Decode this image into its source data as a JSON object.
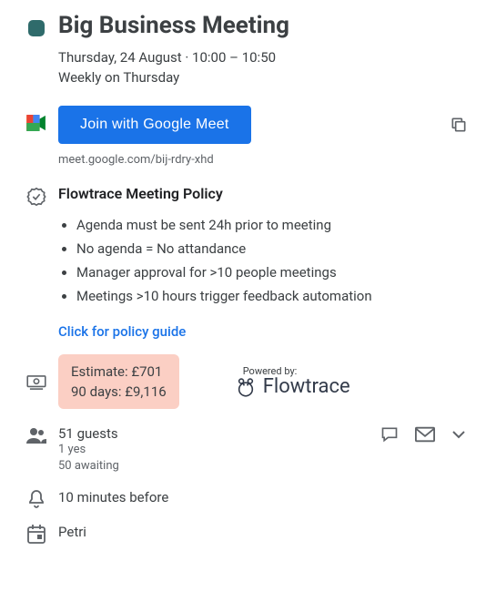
{
  "event": {
    "title": "Big Business Meeting",
    "date_time": "Thursday, 24 August  ·  10:00 – 10:50",
    "recurrence": "Weekly on Thursday"
  },
  "meet": {
    "join_label": "Join with Google Meet",
    "link": "meet.google.com/bij-rdry-xhd"
  },
  "policy": {
    "heading": "Flowtrace Meeting Policy",
    "items": [
      "Agenda must be sent 24h prior to meeting",
      "No agenda = No attandance",
      "Manager approval for >10 people meetings",
      "Meetings >10 hours trigger feedback automation"
    ],
    "guide_link": "Click for policy guide"
  },
  "estimate": {
    "line1": "Estimate: £701",
    "line2": "90 days: £9,116"
  },
  "powered": {
    "label": "Powered by:",
    "brand": "Flowtrace"
  },
  "guests": {
    "count": "51 guests",
    "yes": "1 yes",
    "awaiting": "50 awaiting"
  },
  "reminder": "10 minutes before",
  "calendar_owner": "Petri"
}
